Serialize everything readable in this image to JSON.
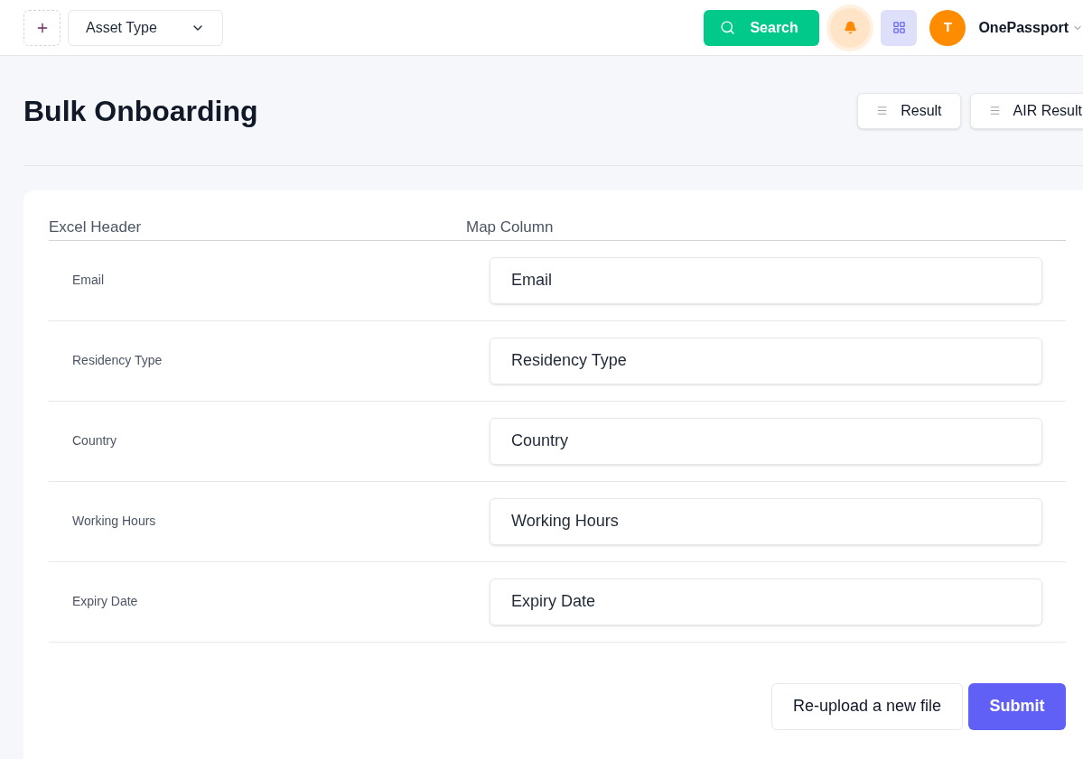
{
  "topbar": {
    "asset_type": "Asset Type",
    "search_button": "Search",
    "avatar_initial": "T",
    "user_name": "OnePassport"
  },
  "page": {
    "title": "Bulk Onboarding",
    "actions": [
      "Result",
      "AIR Result"
    ]
  },
  "mapping": {
    "columns": [
      "Excel Header",
      "Map Column"
    ],
    "rows": [
      {
        "header": "Email",
        "value": "Email"
      },
      {
        "header": "Residency Type",
        "value": "Residency Type"
      },
      {
        "header": "Country",
        "value": "Country"
      },
      {
        "header": "Working Hours",
        "value": "Working Hours"
      },
      {
        "header": "Expiry Date",
        "value": "Expiry Date"
      }
    ]
  },
  "footer": {
    "reupload_button": "Re-upload a new file",
    "submit_button": "Submit"
  }
}
